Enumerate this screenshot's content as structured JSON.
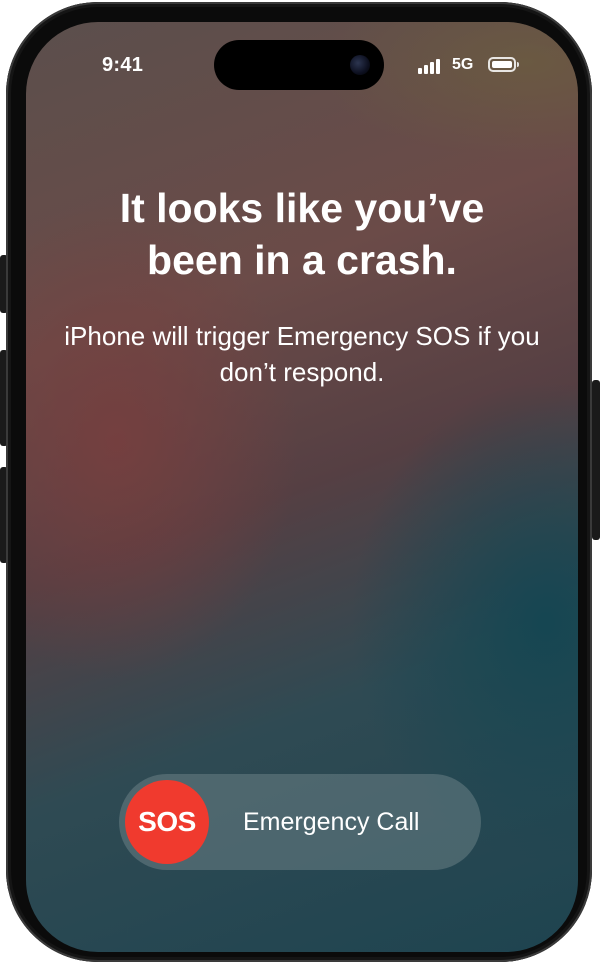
{
  "status_bar": {
    "time": "9:41",
    "network": "5G",
    "icons": [
      "signal-bars-icon",
      "battery-icon"
    ]
  },
  "alert": {
    "title": "It looks like you’ve been in a crash.",
    "message": "iPhone will trigger Emergency SOS if you don’t respond."
  },
  "emergency_slider": {
    "knob_label": "SOS",
    "label": "Emergency Call",
    "knob_color": "#f03a2e"
  }
}
